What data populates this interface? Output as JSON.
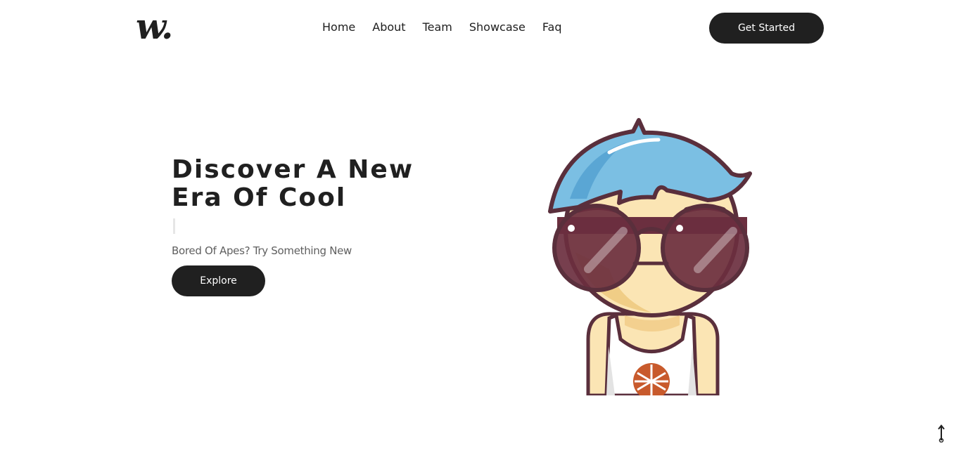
{
  "header": {
    "logo_text": "w.",
    "nav": [
      {
        "label": "Home"
      },
      {
        "label": "About"
      },
      {
        "label": "Team"
      },
      {
        "label": "Showcase"
      },
      {
        "label": "Faq"
      }
    ],
    "cta_label": "Get Started"
  },
  "hero": {
    "title": "Discover A New Era Of Cool",
    "subtitle": "Bored Of Apes? Try Something New",
    "button_label": "Explore"
  },
  "colors": {
    "dark": "#202020",
    "hair": "#7bbfe3",
    "skin": "#fbe5b4",
    "outline": "#5a2f3c",
    "glasses": "#6b2f3f",
    "badge": "#c85a2c"
  },
  "icons": {
    "character": "cartoon-character-with-sunglasses",
    "scroll_top": "arrow-up-icon"
  }
}
